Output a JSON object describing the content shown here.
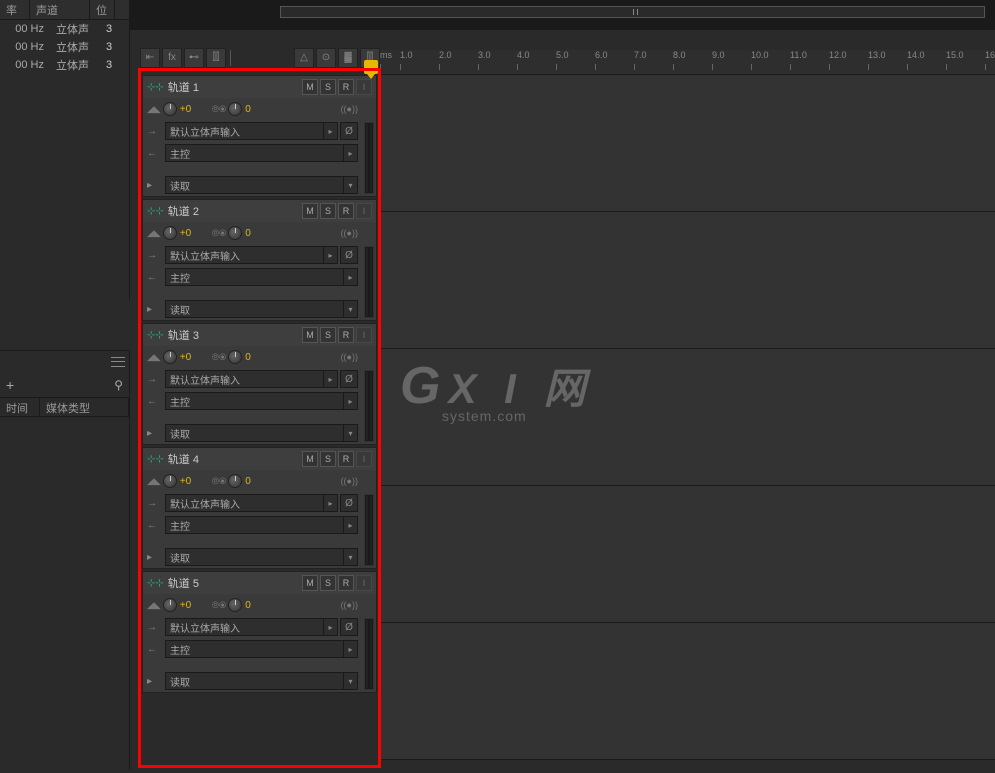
{
  "left_panel": {
    "headers": {
      "rate": "率",
      "channel": "声道",
      "bit": "位"
    },
    "rows": [
      {
        "hz": "00 Hz",
        "ch": "立体声",
        "b": "3"
      },
      {
        "hz": "00 Hz",
        "ch": "立体声",
        "b": "3"
      },
      {
        "hz": "00 Hz",
        "ch": "立体声",
        "b": "3"
      }
    ]
  },
  "left_bottom": {
    "headers": {
      "time": "时间",
      "media_type": "媒体类型"
    }
  },
  "ruler": {
    "unit_label": "ms",
    "ticks": [
      "1.0",
      "2.0",
      "3.0",
      "4.0",
      "5.0",
      "6.0",
      "7.0",
      "8.0",
      "9.0",
      "10.0",
      "11.0",
      "12.0",
      "13.0",
      "14.0",
      "15.0",
      "16"
    ]
  },
  "tracks": [
    {
      "name": "轨道 1",
      "vol": "+0",
      "pan": "0",
      "input": "默认立体声输入",
      "output": "主控",
      "mode": "读取"
    },
    {
      "name": "轨道 2",
      "vol": "+0",
      "pan": "0",
      "input": "默认立体声输入",
      "output": "主控",
      "mode": "读取"
    },
    {
      "name": "轨道 3",
      "vol": "+0",
      "pan": "0",
      "input": "默认立体声输入",
      "output": "主控",
      "mode": "读取"
    },
    {
      "name": "轨道 4",
      "vol": "+0",
      "pan": "0",
      "input": "默认立体声输入",
      "output": "主控",
      "mode": "读取"
    },
    {
      "name": "轨道 5",
      "vol": "+0",
      "pan": "0",
      "input": "默认立体声输入",
      "output": "主控",
      "mode": "读取"
    }
  ],
  "msr": {
    "m": "M",
    "s": "S",
    "r": "R",
    "i": "I"
  },
  "watermark": {
    "big": "GXI 网",
    "small": "system.com"
  }
}
